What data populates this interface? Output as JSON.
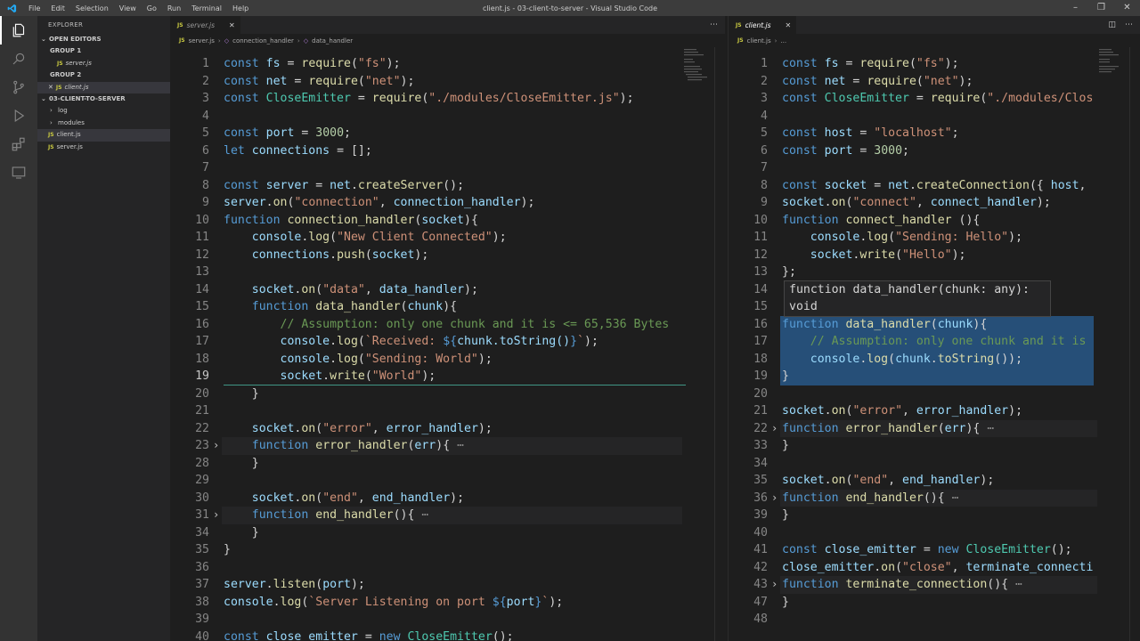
{
  "window": {
    "title": "client.js - 03-client-to-server - Visual Studio Code",
    "menu": [
      "File",
      "Edit",
      "Selection",
      "View",
      "Go",
      "Run",
      "Terminal",
      "Help"
    ]
  },
  "sidebar": {
    "header": "EXPLORER",
    "open_editors": "OPEN EDITORS",
    "group1": "GROUP 1",
    "group1_file": "server.js",
    "group2": "GROUP 2",
    "group2_file": "client.js",
    "project": "03-CLIENT-TO-SERVER",
    "tree": [
      "log",
      "modules",
      "client.js",
      "server.js"
    ]
  },
  "editor_left": {
    "tab": "server.js",
    "breadcrumb": [
      "server.js",
      "connection_handler",
      "data_handler"
    ],
    "line_numbers": [
      "1",
      "2",
      "3",
      "4",
      "5",
      "6",
      "7",
      "8",
      "9",
      "10",
      "11",
      "12",
      "13",
      "14",
      "15",
      "16",
      "17",
      "18",
      "19",
      "20",
      "21",
      "22",
      "23",
      "28",
      "29",
      "30",
      "31",
      "34",
      "35",
      "36",
      "37",
      "38",
      "39",
      "40"
    ],
    "lines": [
      "const fs = require(\"fs\");",
      "const net = require(\"net\");",
      "const CloseEmitter = require(\"./modules/CloseEmitter.js\");",
      "",
      "const port = 3000;",
      "let connections = [];",
      "",
      "const server = net.createServer();",
      "server.on(\"connection\", connection_handler);",
      "function connection_handler(socket){",
      "    console.log(\"New Client Connected\");",
      "    connections.push(socket);",
      "",
      "    socket.on(\"data\", data_handler);",
      "    function data_handler(chunk){",
      "        // Assumption: only one chunk and it is <= 65,536 Bytes",
      "        console.log(`Received: ${chunk.toString()}`);",
      "        console.log(\"Sending: World\");",
      "        socket.write(\"World\");",
      "    }",
      "",
      "    socket.on(\"error\", error_handler);",
      "    function error_handler(err){ ⋯",
      "    }",
      "",
      "    socket.on(\"end\", end_handler);",
      "    function end_handler(){ ⋯",
      "    }",
      "}",
      "",
      "server.listen(port);",
      "console.log(`Server Listening on port ${port}`);",
      "",
      "const close_emitter = new CloseEmitter();"
    ]
  },
  "editor_right": {
    "tab": "client.js",
    "breadcrumb": [
      "client.js",
      "..."
    ],
    "hover_tooltip": "function data_handler(chunk: any): void",
    "line_numbers": [
      "1",
      "2",
      "3",
      "4",
      "5",
      "6",
      "7",
      "8",
      "9",
      "10",
      "11",
      "12",
      "13",
      "14",
      "15",
      "16",
      "17",
      "18",
      "19",
      "20",
      "21",
      "22",
      "33",
      "34",
      "35",
      "36",
      "39",
      "40",
      "41",
      "42",
      "43",
      "47",
      "48"
    ],
    "lines": [
      "const fs = require(\"fs\");",
      "const net = require(\"net\");",
      "const CloseEmitter = require(\"./modules/Clos",
      "",
      "const host = \"localhost\";",
      "const port = 3000;",
      "",
      "const socket = net.createConnection({ host,",
      "socket.on(\"connect\", connect_handler);",
      "function connect_handler (){",
      "    console.log(\"Sending: Hello\");",
      "    socket.write(\"Hello\");",
      "};",
      "",
      "",
      "function data_handler(chunk){",
      "    // Assumption: only one chunk and it is",
      "    console.log(chunk.toString());",
      "}",
      "",
      "socket.on(\"error\", error_handler);",
      "function error_handler(err){ ⋯",
      "}",
      "",
      "socket.on(\"end\", end_handler);",
      "function end_handler(){ ⋯",
      "}",
      "",
      "const close_emitter = new CloseEmitter();",
      "close_emitter.on(\"close\", terminate_connecti",
      "function terminate_connection(){ ⋯",
      "}",
      ""
    ]
  }
}
